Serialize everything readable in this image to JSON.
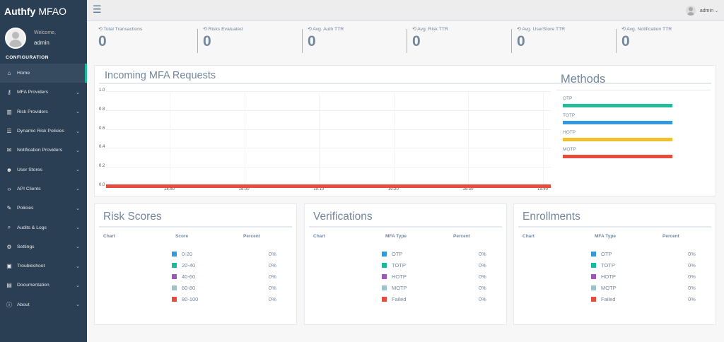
{
  "brand": {
    "name": "Authfy",
    "suffix": "MFAO"
  },
  "profile": {
    "welcome": "Welcome,",
    "name": "admin"
  },
  "sidebar": {
    "section": "CONFIGURATION",
    "items": [
      {
        "label": "Home",
        "icon": "home-icon",
        "glyph": "⌂",
        "has_chevron": false
      },
      {
        "label": "MFA Providers",
        "icon": "key-icon",
        "glyph": "⚷",
        "has_chevron": true
      },
      {
        "label": "Risk Providers",
        "icon": "bar-chart-icon",
        "glyph": "▥",
        "has_chevron": true
      },
      {
        "label": "Dynamic Risk Policies",
        "icon": "sliders-icon",
        "glyph": "☰",
        "has_chevron": true
      },
      {
        "label": "Notification Providers",
        "icon": "envelope-icon",
        "glyph": "✉",
        "has_chevron": true
      },
      {
        "label": "User Stores",
        "icon": "users-icon",
        "glyph": "☻",
        "has_chevron": true
      },
      {
        "label": "API Clients",
        "icon": "code-icon",
        "glyph": "‹›",
        "has_chevron": true
      },
      {
        "label": "Policies",
        "icon": "edit-icon",
        "glyph": "✎",
        "has_chevron": true
      },
      {
        "label": "Audits & Logs",
        "icon": "search-icon",
        "glyph": "⌕",
        "has_chevron": true
      },
      {
        "label": "Settings",
        "icon": "gears-icon",
        "glyph": "⚙",
        "has_chevron": true
      },
      {
        "label": "Troubleshoot",
        "icon": "toolbox-icon",
        "glyph": "▣",
        "has_chevron": true
      },
      {
        "label": "Documentation",
        "icon": "book-icon",
        "glyph": "▤",
        "has_chevron": true
      },
      {
        "label": "About",
        "icon": "info-icon",
        "glyph": "ⓘ",
        "has_chevron": true
      }
    ]
  },
  "topbar": {
    "user": "admin"
  },
  "stats": [
    {
      "label": "Total Transactions",
      "value": "0"
    },
    {
      "label": "Risks Evaluated",
      "value": "0"
    },
    {
      "label": "Avg. Auth TTR",
      "value": "0"
    },
    {
      "label": "Avg. Risk TTR",
      "value": "0"
    },
    {
      "label": "Avg. UserStore TTR",
      "value": "0"
    },
    {
      "label": "Avg. Notification TTR",
      "value": "0"
    }
  ],
  "incoming": {
    "title": "Incoming MFA Requests",
    "methods_title": "Methods",
    "methods": [
      {
        "label": "OTP",
        "color": "#26b99a"
      },
      {
        "label": "TOTP",
        "color": "#3498db"
      },
      {
        "label": "HOTP",
        "color": "#f0c02f"
      },
      {
        "label": "MOTP",
        "color": "#e74c3c"
      }
    ]
  },
  "chart_data": {
    "type": "line",
    "title": "Incoming MFA Requests",
    "x": [
      "18:50",
      "19:00",
      "19:10",
      "19:20",
      "19:30",
      "19:40"
    ],
    "ylim": [
      0,
      1.0
    ],
    "yticks": [
      "1.0",
      "0.8",
      "0.6",
      "0.4",
      "0.2",
      "0.0"
    ],
    "grid": true,
    "series": [
      {
        "values": [
          0,
          0,
          0,
          0,
          0,
          0
        ],
        "color": "#e74c3c"
      }
    ]
  },
  "panels": [
    {
      "title": "Risk Scores",
      "headers": [
        "Chart",
        "Score",
        "Percent"
      ],
      "rows": [
        {
          "label": "0-20",
          "percent": "0%",
          "color": "#3498db"
        },
        {
          "label": "20-40",
          "percent": "0%",
          "color": "#1abb9c"
        },
        {
          "label": "40-60",
          "percent": "0%",
          "color": "#9b59b6"
        },
        {
          "label": "60-80",
          "percent": "0%",
          "color": "#9cc2cb"
        },
        {
          "label": "80-100",
          "percent": "0%",
          "color": "#e74c3c"
        }
      ]
    },
    {
      "title": "Verifications",
      "headers": [
        "Chart",
        "MFA Type",
        "Percent"
      ],
      "rows": [
        {
          "label": "OTP",
          "percent": "0%",
          "color": "#3498db"
        },
        {
          "label": "TOTP",
          "percent": "0%",
          "color": "#1abb9c"
        },
        {
          "label": "HOTP",
          "percent": "0%",
          "color": "#9b59b6"
        },
        {
          "label": "MOTP",
          "percent": "0%",
          "color": "#9cc2cb"
        },
        {
          "label": "Failed",
          "percent": "0%",
          "color": "#e74c3c"
        }
      ]
    },
    {
      "title": "Enrollments",
      "headers": [
        "Chart",
        "MFA Type",
        "Percent"
      ],
      "rows": [
        {
          "label": "OTP",
          "percent": "0%",
          "color": "#3498db"
        },
        {
          "label": "TOTP",
          "percent": "0%",
          "color": "#1abb9c"
        },
        {
          "label": "HOTP",
          "percent": "0%",
          "color": "#9b59b6"
        },
        {
          "label": "MOTP",
          "percent": "0%",
          "color": "#9cc2cb"
        },
        {
          "label": "Failed",
          "percent": "0%",
          "color": "#e74c3c"
        }
      ]
    }
  ]
}
